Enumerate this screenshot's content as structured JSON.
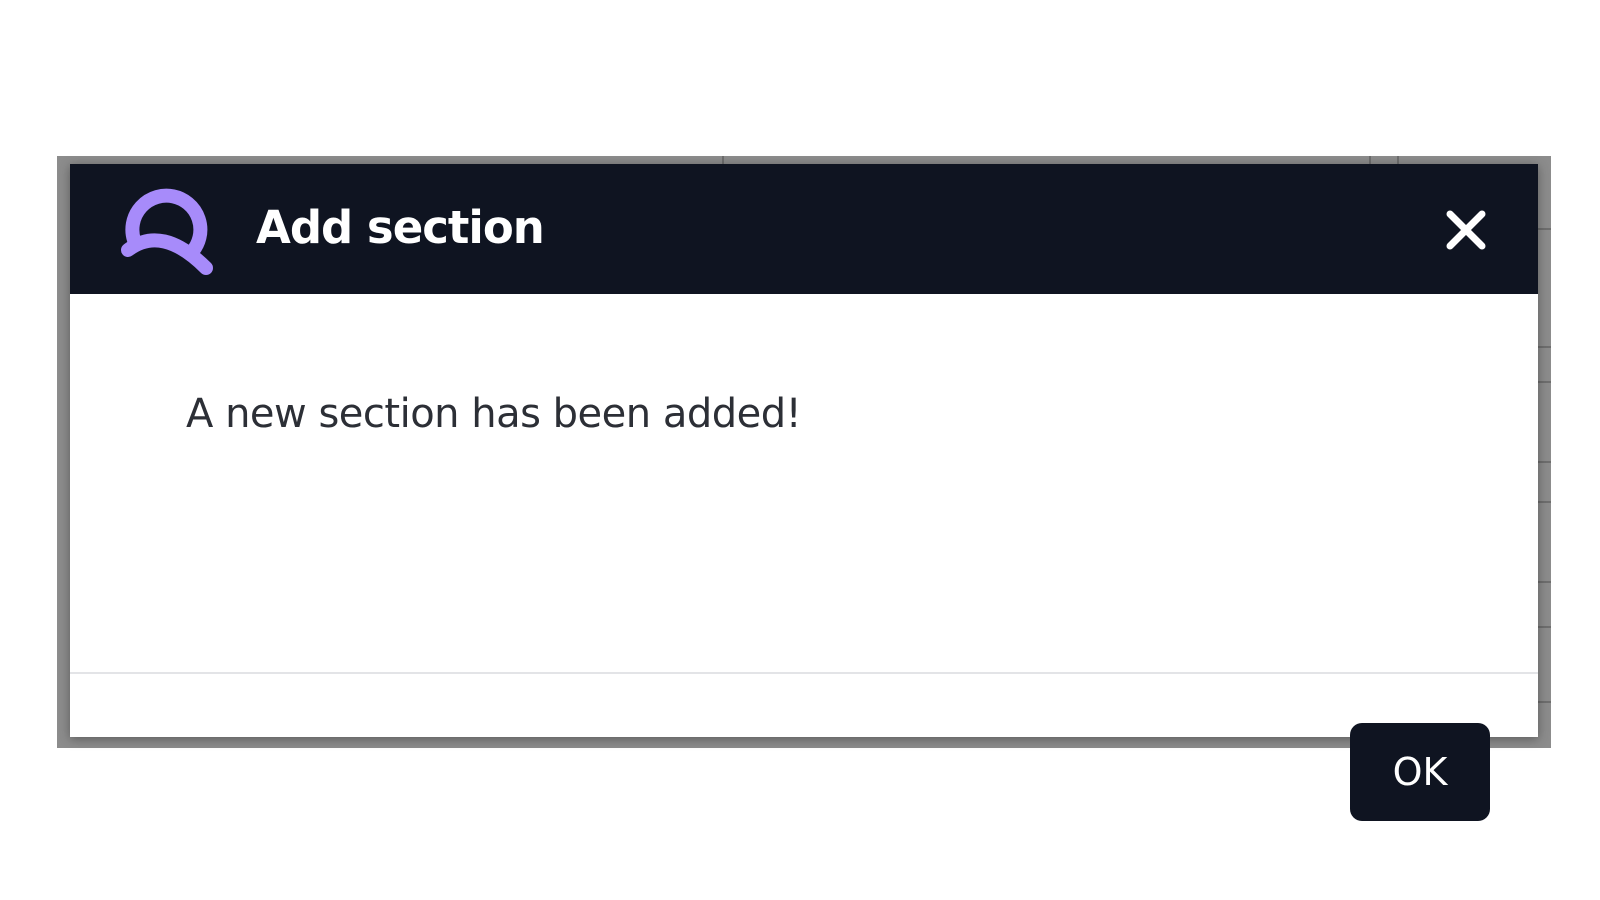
{
  "dialog": {
    "title": "Add section",
    "message": "A new section has been added!",
    "ok_label": "OK",
    "icons": {
      "logo": "app-logo-icon",
      "close": "close-icon"
    }
  },
  "colors": {
    "header_bg": "#0f1421",
    "logo_accent": "#a78bfa",
    "button_bg": "#0f1421",
    "message_text": "#2c2f36"
  }
}
